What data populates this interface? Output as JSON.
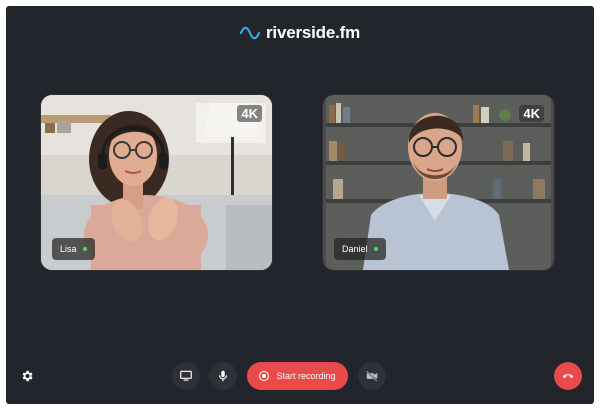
{
  "app": {
    "brand_name": "riverside.fm",
    "brand_icon": "wave-icon",
    "accent_color": "#ea4a4a",
    "background_color": "#22252b"
  },
  "participants": [
    {
      "name": "Lisa",
      "quality_badge": "4K",
      "online": true
    },
    {
      "name": "Daniel",
      "quality_badge": "4K",
      "online": true
    }
  ],
  "controls": {
    "settings_icon": "gear-icon",
    "screen_share_icon": "monitor-icon",
    "mic_icon": "microphone-icon",
    "record_label": "Start recording",
    "camera_icon": "camera-off-icon",
    "end_call_icon": "phone-hangup-icon"
  }
}
